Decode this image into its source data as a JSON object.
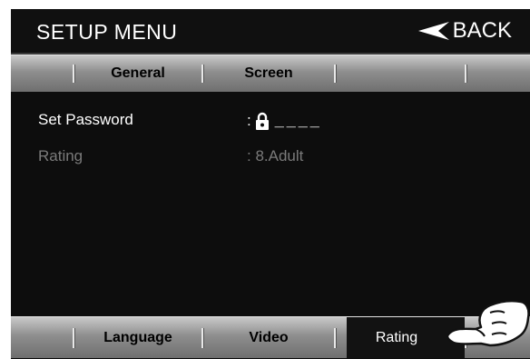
{
  "header": {
    "title": "SETUP MENU",
    "back_label": "BACK"
  },
  "top_tabs": [
    {
      "label": "General"
    },
    {
      "label": "Screen"
    },
    {
      "label": ""
    }
  ],
  "settings": {
    "password": {
      "label": "Set Password",
      "separator": ":",
      "value": "____",
      "icon": "lock-icon"
    },
    "rating": {
      "label": "Rating",
      "value": ": 8.Adult"
    }
  },
  "bottom_tabs": [
    {
      "label": "Language"
    },
    {
      "label": "Video"
    },
    {
      "label": "Rating",
      "active": true
    }
  ],
  "colors": {
    "background": "#0d0d0d",
    "text_enabled": "#ffffff",
    "text_disabled": "#7a7a7a",
    "tabbar": "#8e8e8e",
    "tab_active": "#121212"
  }
}
